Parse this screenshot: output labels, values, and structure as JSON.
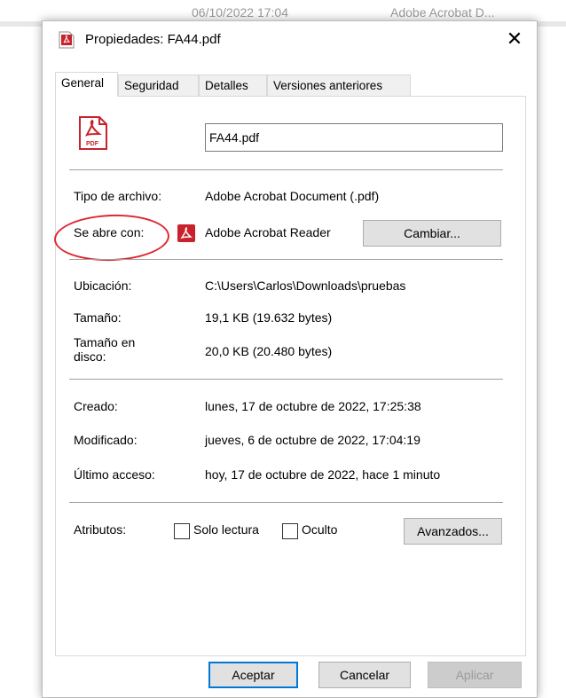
{
  "background": {
    "date_text": "06/10/2022 17:04",
    "app_text": "Adobe Acrobat D..."
  },
  "dialog": {
    "title": "Propiedades: FA44.pdf",
    "close_label": "✕",
    "tabs": [
      {
        "label": "General",
        "active": true
      },
      {
        "label": "Seguridad",
        "active": false
      },
      {
        "label": "Detalles",
        "active": false
      },
      {
        "label": "Versiones anteriores",
        "active": false
      }
    ],
    "file_icon_text": "PDF",
    "filename": "FA44.pdf",
    "tipo_label": "Tipo de archivo:",
    "tipo_value": "Adobe Acrobat Document (.pdf)",
    "abre_label": "Se abre con:",
    "abre_value": "Adobe Acrobat Reader",
    "cambiar_button": "Cambiar...",
    "ubicacion_label": "Ubicación:",
    "ubicacion_value": "C:\\Users\\Carlos\\Downloads\\pruebas",
    "tamano_label": "Tamaño:",
    "tamano_value": "19,1 KB (19.632 bytes)",
    "tamano_disco_label_1": "Tamaño en",
    "tamano_disco_label_2": "disco:",
    "tamano_disco_value": "20,0 KB (20.480 bytes)",
    "creado_label": "Creado:",
    "creado_value": "lunes, 17 de octubre de 2022, 17:25:38",
    "modificado_label": "Modificado:",
    "modificado_value": "jueves, 6 de octubre de 2022, 17:04:19",
    "acceso_label": "Último acceso:",
    "acceso_value": "hoy, 17 de octubre de 2022, hace 1 minuto",
    "atributos_label": "Atributos:",
    "solo_lectura_label": "Solo lectura",
    "oculto_label": "Oculto",
    "avanzados_button": "Avanzados...",
    "aceptar_button": "Aceptar",
    "cancelar_button": "Cancelar",
    "aplicar_button": "Aplicar"
  },
  "colors": {
    "pdf_red": "#c8232c",
    "annotation_red": "#e0262f",
    "focus_blue": "#0078d7"
  }
}
